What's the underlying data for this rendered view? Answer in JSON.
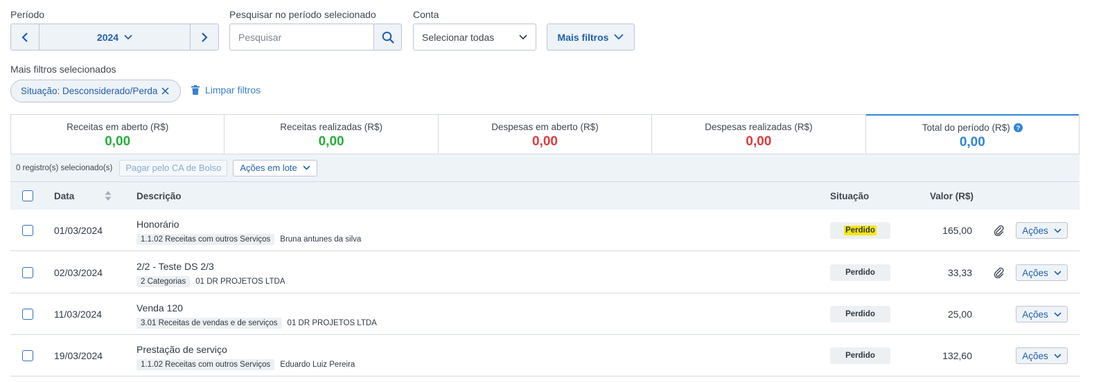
{
  "filters": {
    "period_label": "Período",
    "year": "2024",
    "search_label": "Pesquisar no período selecionado",
    "search_placeholder": "Pesquisar",
    "account_label": "Conta",
    "account_value": "Selecionar todas",
    "more_filters": "Mais filtros",
    "selected_label": "Mais filtros selecionados",
    "chip": "Situação: Desconsiderado/Perda",
    "clear": "Limpar filtros"
  },
  "summary": [
    {
      "title": "Receitas em aberto (R$)",
      "value": "0,00",
      "color": "#27ae3b"
    },
    {
      "title": "Receitas realizadas (R$)",
      "value": "0,00",
      "color": "#27ae3b"
    },
    {
      "title": "Despesas em aberto (R$)",
      "value": "0,00",
      "color": "#e23a3a"
    },
    {
      "title": "Despesas realizadas (R$)",
      "value": "0,00",
      "color": "#e23a3a"
    },
    {
      "title": "Total do período (R$)",
      "value": "0,00",
      "color": "#2f85d6",
      "icon": "help-icon"
    }
  ],
  "bulk": {
    "count": "0 registro(s) selecionado(s)",
    "pay": "Pagar pelo CA de Bolso",
    "batch": "Ações em lote"
  },
  "table": {
    "headers": {
      "date": "Data",
      "description": "Descrição",
      "status": "Situação",
      "value": "Valor (R$)"
    },
    "rows": [
      {
        "date": "01/03/2024",
        "description": "Honorário",
        "category": "1.1.02 Receitas com outros Serviços",
        "contact": "Bruna antunes da silva",
        "status": "Perdido",
        "value": "165,00",
        "attachment": true,
        "actions": "Ações"
      },
      {
        "date": "02/03/2024",
        "description": "2/2 - Teste DS 2/3",
        "category": "2 Categorias",
        "contact": "01 DR PROJETOS LTDA",
        "status": "Perdido",
        "value": "33,33",
        "attachment": true,
        "actions": "Ações"
      },
      {
        "date": "11/03/2024",
        "description": "Venda 120",
        "category": "3.01 Receitas de vendas e de serviços",
        "contact": "01 DR PROJETOS LTDA",
        "status": "Perdido",
        "value": "25,00",
        "attachment": false,
        "actions": "Ações"
      },
      {
        "date": "19/03/2024",
        "description": "Prestação de serviço",
        "category": "1.1.02 Receitas com outros Serviços",
        "contact": "Eduardo Luiz Pereira",
        "status": "Perdido",
        "value": "132,60",
        "attachment": false,
        "actions": "Ações"
      }
    ]
  }
}
